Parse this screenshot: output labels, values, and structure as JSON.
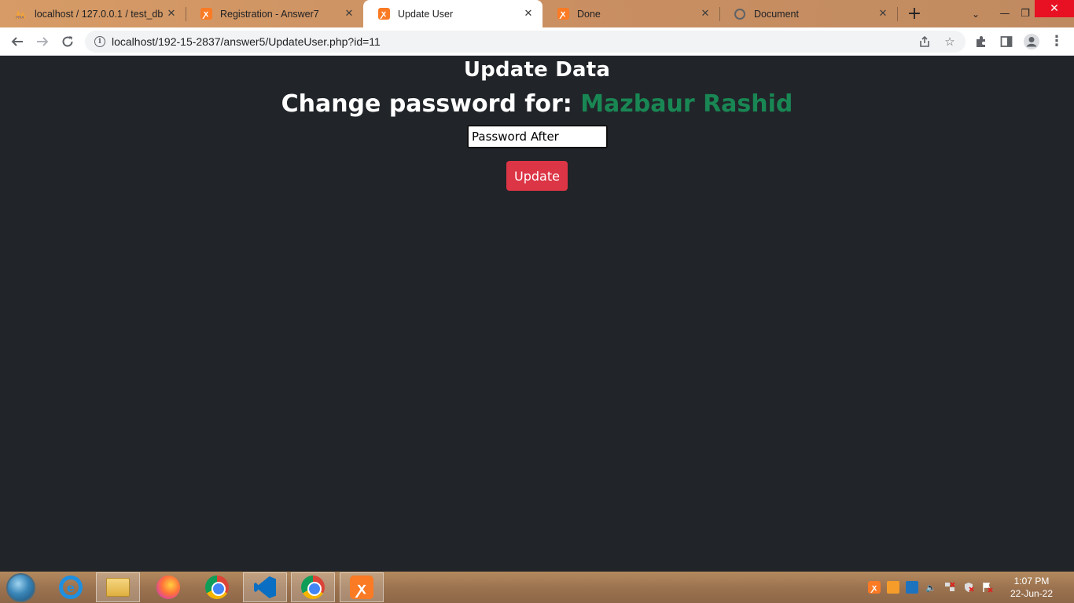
{
  "browser": {
    "tabs": [
      {
        "title": "localhost / 127.0.0.1 / test_db /",
        "icon": "phpmyadmin-icon",
        "active": false
      },
      {
        "title": "Registration - Answer7",
        "icon": "xampp-icon",
        "active": false
      },
      {
        "title": "Update User",
        "icon": "xampp-icon",
        "active": true
      },
      {
        "title": "Done",
        "icon": "xampp-icon",
        "active": false
      },
      {
        "title": "Document",
        "icon": "globe-icon",
        "active": false
      }
    ],
    "url": "localhost/192-15-2837/answer5/UpdateUser.php?id=11"
  },
  "page": {
    "heading": "Update Data",
    "change_label": "Change password for: ",
    "user_name": "Mazbaur Rashid",
    "password_value": "Password After",
    "update_label": "Update",
    "colors": {
      "background": "#212529",
      "username": "#198754",
      "button": "#dc3545"
    }
  },
  "taskbar": {
    "apps": [
      "internet-explorer-icon",
      "file-explorer-icon",
      "firefox-icon",
      "chrome-icon",
      "vscode-icon",
      "chrome-icon",
      "xampp-icon"
    ],
    "time": "1:07 PM",
    "date": "22-Jun-22"
  }
}
